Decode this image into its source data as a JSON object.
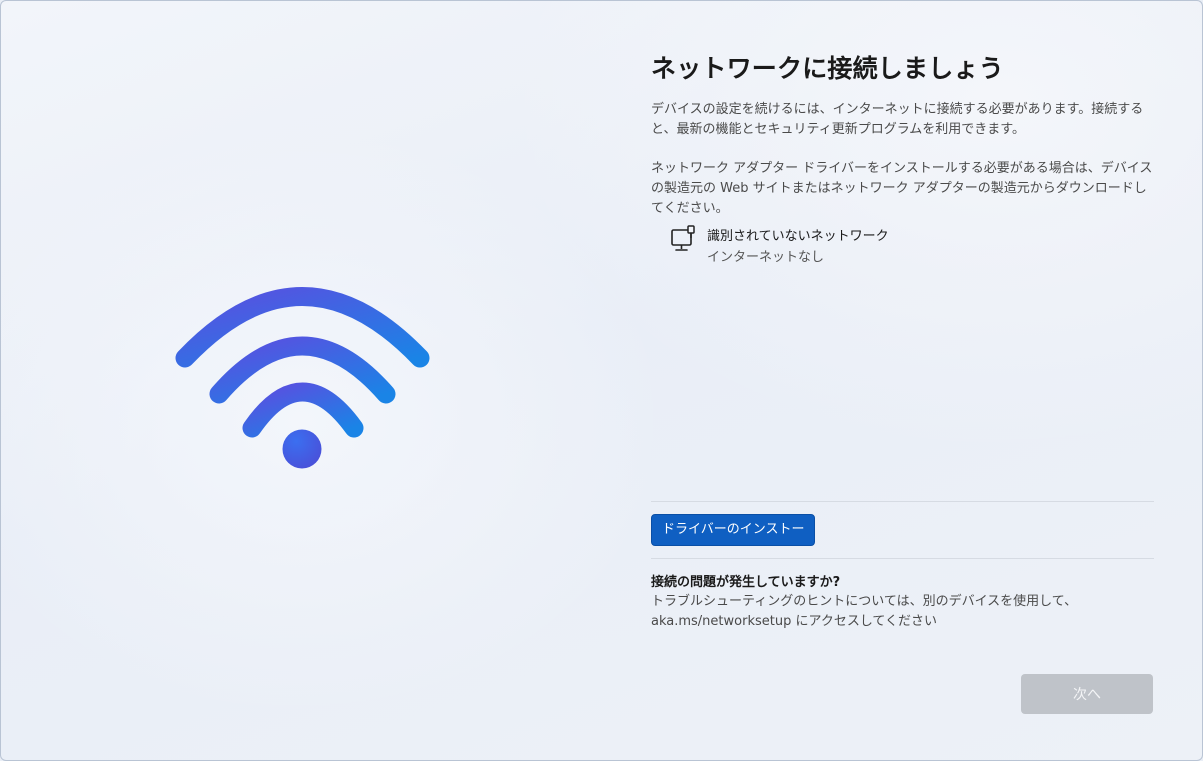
{
  "page": {
    "title": "ネットワークに接続しましょう",
    "description_1": "デバイスの設定を続けるには、インターネットに接続する必要があります。接続すると、最新の機能とセキュリティ更新プログラムを利用できます。",
    "description_2": "ネットワーク アダプター ドライバーをインストールする必要がある場合は、デバイスの製造元の Web サイトまたはネットワーク アダプターの製造元からダウンロードしてください。"
  },
  "network": {
    "icon": "wired-network-icon",
    "name": "識別されていないネットワーク",
    "status": "インターネットなし"
  },
  "install_driver": {
    "label": "ドライバーのインストー"
  },
  "help": {
    "title": "接続の問題が発生していますか?",
    "text": "トラブルシューティングのヒントについては、別のデバイスを使用して、aka.ms/networksetup にアクセスしてください"
  },
  "next": {
    "label": "次へ",
    "enabled": false
  },
  "illustration": {
    "icon": "wifi-icon"
  },
  "colors": {
    "accent": "#0f5fc2",
    "wifi_gradient_start": "#5b4fe0",
    "wifi_gradient_end": "#1f7fe0",
    "disabled_button": "#bfc3c9"
  }
}
